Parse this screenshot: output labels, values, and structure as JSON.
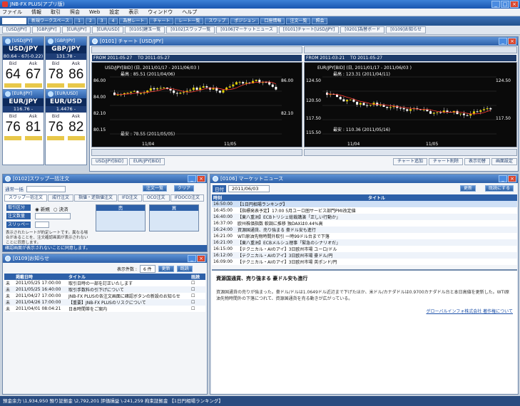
{
  "app": {
    "title": "JNB-FX PLUS(アプリ版)"
  },
  "menu": [
    "ファイル",
    "情報",
    "取引",
    "照会",
    "Web",
    "設定",
    "表示",
    "ウィンドウ",
    "ヘルプ"
  ],
  "toolbar1": [
    "新規ワークスペース",
    "1",
    "2",
    "3",
    "4",
    "為替レート",
    "チャート",
    "レート一覧",
    "スワップ",
    "ポジション",
    "口座情報",
    "注文一覧",
    "照会"
  ],
  "toolbar2": [
    "[USD/JPY]",
    "[GBP/JPY]",
    "[EUR/JPY]",
    "[EUR/USD]",
    "[0105]建玉一覧",
    "[0102]スワップ一覧",
    "[0106]マーケットニュース",
    "[0101]チャート[USD/JPY]",
    "[0201]為替ボード",
    "[0109]お知らせ"
  ],
  "rates": [
    {
      "pair": "USD/JPY",
      "title": "[USD/JPY]",
      "change": "80.64 - 67(-0.22)",
      "bid_label": "Bid",
      "ask_label": "Ask",
      "bid": "64",
      "ask": "67"
    },
    {
      "pair": "GBP/JPY",
      "title": "[GBP/JPY]",
      "change": "131.78 - 86(-0.82)",
      "bid_label": "Bid",
      "ask_label": "Ask",
      "bid": "78",
      "ask": "86"
    },
    {
      "pair": "EUR/JPY",
      "title": "[EUR/JPY]",
      "change": "116.76 - 81(-0.42)",
      "bid_label": "Bid",
      "ask_label": "Ask",
      "bid": "76",
      "ask": "81"
    },
    {
      "pair": "EUR/USD",
      "title": "[EUR/USD]",
      "change": "1.4476 - 82(-0.0008)",
      "bid_label": "Bid",
      "ask_label": "Ask",
      "bid": "76",
      "ask": "82"
    }
  ],
  "chart_window": {
    "title": "[0101] チャート [USD/JPY]",
    "left": {
      "from": "FROM 2011-05-27",
      "to": "TO 2011-05-27",
      "label": "USD/JPY[BID] (日, 2011/01/17 - 2011/06/03 )",
      "high": "最高 : 85.51 (2011/04/06)",
      "low": "最安 : 78.55 (2011/05/05)",
      "price_labels": [
        "86.00",
        "84.00",
        "82.10",
        "80.15",
        "78.20"
      ],
      "date_labels": [
        "11/04",
        "11/05"
      ]
    },
    "right": {
      "from": "FROM 2011-03-21",
      "to": "TO 2011-05-27",
      "label": "EUR/JPY[BID] (日, 2011/01/17 - 2011/06/03 )",
      "high": "最高 : 123.31 (2011/04/11)",
      "low": "最安 : 110.36 (2011/05/16)",
      "price_labels": [
        "124.50",
        "120.50",
        "117.50",
        "115.50"
      ],
      "date_labels": [
        "11/04",
        "11/05"
      ]
    },
    "bottom_tabs": [
      "USD/JPY[BID]",
      "EUR/JPY[BID]"
    ],
    "bottom_buttons": [
      "チャート追加",
      "チャート削除",
      "表示切替",
      "画面設定"
    ]
  },
  "order": {
    "title": "[0102]スワップ一括注文",
    "selector": "通常一括",
    "buttons": [
      "注文一覧",
      "クリア"
    ],
    "tabs": [
      "スワップ一括注文",
      "成行注文",
      "指値・逆指値注文",
      "IFD注文",
      "OCO注文",
      "IFDOCO注文"
    ],
    "fields": [
      "取引区分",
      "注文数量",
      "スリッページ"
    ],
    "radio_new": "新規",
    "radio_settle": "決済",
    "sell": "売",
    "buy": "買",
    "note": "表示されたレートが約定レートです。異なる場合があることを、注文確認画面が表示されないことに同意します。",
    "status": "確認画面が表示されないことに同意します。"
  },
  "notice": {
    "title": "[0109]お知らせ",
    "count_label": "表示件数 :",
    "count": "6 件",
    "buttons": [
      "更新",
      "既読"
    ],
    "headers": [
      "",
      "掲載日時",
      "タイトル",
      "既読"
    ],
    "rows": [
      [
        "未",
        "2011/05/25 17:00:00",
        "取引日時の一部を訂正いたします"
      ],
      [
        "未",
        "2011/05/25 16:40:00",
        "取引手数料の引下げについて"
      ],
      [
        "未",
        "2011/04/27 17:00:00",
        "JNB-FX PLUSの各注文画面に確認ボタンの新設のお知らせ"
      ],
      [
        "未",
        "2011/04/26 17:00:00",
        "【重要】JNB-FX PLUSのリスクについて"
      ],
      [
        "未",
        "2011/04/01 08:04:21",
        "日本時間帯をご案内"
      ]
    ]
  },
  "news": {
    "title": "[0106] マーケットニュース",
    "date_label": "日付",
    "date": "2011/06/03",
    "buttons": [
      "更新",
      "既読にする"
    ],
    "headers": [
      "時刻",
      "タイトル"
    ],
    "rows": [
      [
        "16:50:00",
        "【1日円相場ランキング】"
      ],
      [
        "16:45:00",
        "【指標発表予定】17:00 5月ユーロ圏サービス部門PMI改定値"
      ],
      [
        "16:40:00",
        "【東八重洲】ECBトリシェ総裁講演「正しい行動か」"
      ],
      [
        "16:37:00",
        "欧州株価指数 軟調に推移 独DAXは0.44%高"
      ],
      [
        "16:24:00",
        "資源国通貨、売り強まる 豪ドル安も進行"
      ],
      [
        "16:21:00",
        "WTI原油先物時間外取引 一時99ドル台まで下落"
      ],
      [
        "16:21:00",
        "【東八重洲】ECBメルシュ理事「緊急のシナリオだ」"
      ],
      [
        "16:15:00",
        "【テクニカル・AIのアイ】3日欧州市場 ユーロ/ドル"
      ],
      [
        "16:12:00",
        "【テクニカル・AIのアイ】3日欧州市場 豪ドル/円"
      ],
      [
        "16:09:00",
        "【テクニカル・AIのアイ】3日欧州市場 英ポンド/円"
      ]
    ],
    "article_title": "資源国通貨、売り強まる 豪ドル安も進行",
    "article_body": "資源国通貨の売りが強まった。豪ドル/ドルは1.0649ドル近辺まで下げたほか、米ドル/カナダドルは0.9700カナダドル台と本日高値を更新した。WTI原油先物時間外の下落につれて、資源国通貨を売る動きが広がっている。",
    "article_link": "グローバルインフォ株式会社 著作権について"
  },
  "status": {
    "text": "預金余力 \\1,934,950  預り証拠金 \\2,792,201  評価損益 \\-241,259  拘束証拠金  【1日円相場ランキング】"
  },
  "colors": {
    "candle_up": "#e0d000",
    "candle_down": "#ffffff",
    "line": "#ff3b30",
    "accent": "#2d60a8"
  }
}
